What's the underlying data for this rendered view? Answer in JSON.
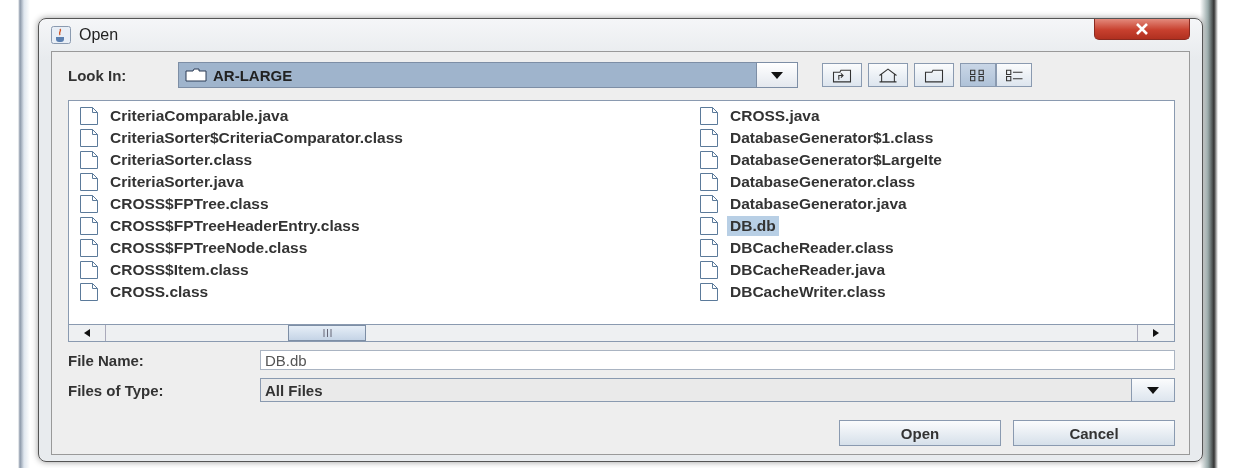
{
  "window": {
    "title": "Open"
  },
  "look_in": {
    "label": "Look In:",
    "value": "AR-LARGE"
  },
  "toolbar": [
    {
      "kind": "up"
    },
    {
      "kind": "home"
    },
    {
      "kind": "new-folder"
    },
    {
      "kind": "list",
      "selected": true
    },
    {
      "kind": "details",
      "selected": false
    }
  ],
  "files": [
    {
      "name": "CriteriaComparable.java",
      "selected": false
    },
    {
      "name": "CriteriaSorter$CriteriaComparator.class",
      "selected": false
    },
    {
      "name": "CriteriaSorter.class",
      "selected": false
    },
    {
      "name": "CriteriaSorter.java",
      "selected": false
    },
    {
      "name": "CROSS$FPTree.class",
      "selected": false
    },
    {
      "name": "CROSS$FPTreeHeaderEntry.class",
      "selected": false
    },
    {
      "name": "CROSS$FPTreeNode.class",
      "selected": false
    },
    {
      "name": "CROSS$Item.class",
      "selected": false
    },
    {
      "name": "CROSS.class",
      "selected": false
    },
    {
      "name": "CROSS.java",
      "selected": false
    },
    {
      "name": "DatabaseGenerator$1.class",
      "selected": false
    },
    {
      "name": "DatabaseGenerator$LargeIte",
      "selected": false
    },
    {
      "name": "DatabaseGenerator.class",
      "selected": false
    },
    {
      "name": "DatabaseGenerator.java",
      "selected": false
    },
    {
      "name": "DB.db",
      "selected": true
    },
    {
      "name": "DBCacheReader.class",
      "selected": false
    },
    {
      "name": "DBCacheReader.java",
      "selected": false
    },
    {
      "name": "DBCacheWriter.class",
      "selected": false
    }
  ],
  "file_name": {
    "label": "File Name:",
    "value": "DB.db"
  },
  "file_type": {
    "label": "Files of Type:",
    "value": "All Files"
  },
  "buttons": [
    "Open",
    "Cancel"
  ]
}
